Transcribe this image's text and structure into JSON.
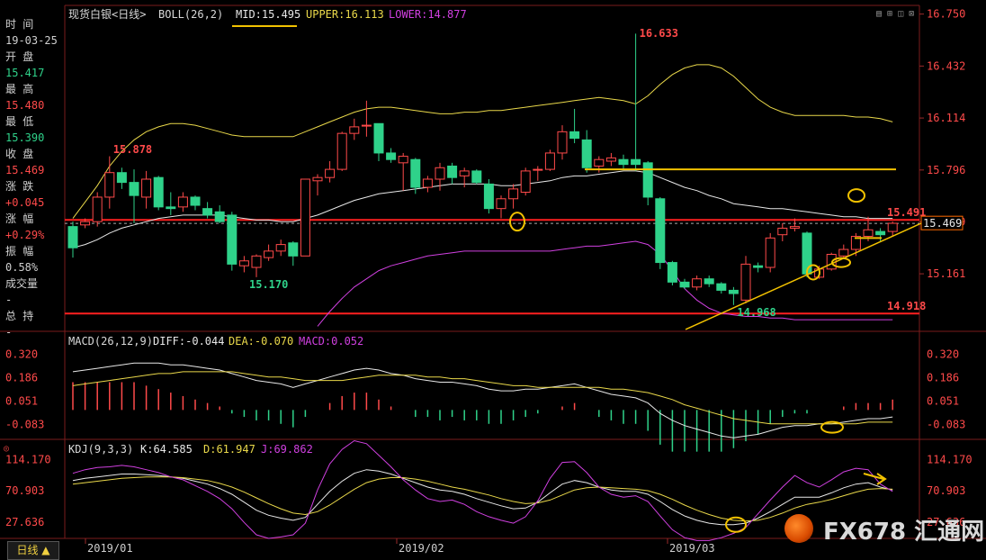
{
  "colors": {
    "up": "#ff4a4a",
    "down": "#2fd28a",
    "mid": "#e8e8e8",
    "upper": "#e9d84a",
    "lower": "#d040e0",
    "diff": "#e8e8e8",
    "dea": "#e9d84a",
    "k": "#e8e8e8",
    "d": "#e9d84a",
    "j": "#d040e0",
    "annot": "#f2c200",
    "level": "#ff2020"
  },
  "header": {
    "title": "现货白银<日线>",
    "indicator": "BOLL(26,2)",
    "mid": "MID:15.495",
    "upper": "UPPER:16.113",
    "lower": "LOWER:14.877"
  },
  "info_panel": {
    "time_label": "时 间",
    "time_value": "19-03-25",
    "open_label": "开 盘",
    "open_value": "15.417",
    "high_label": "最 高",
    "high_value": "15.480",
    "low_label": "最 低",
    "low_value": "15.390",
    "close_label": "收 盘",
    "close_value": "15.469",
    "change_label": "涨 跌",
    "change_value": "+0.045",
    "pct_label": "涨 幅",
    "pct_value": "+0.29%",
    "amp_label": "振 幅",
    "amp_value": "0.58%",
    "vol_label": "成交量",
    "vol_value": "-",
    "hold_label": "总 持",
    "hold_value": "-"
  },
  "tab": {
    "label": "日线 ▲"
  },
  "watermark": {
    "text": "FX678 汇通网"
  },
  "macd_header": {
    "name": "MACD(26,12,9)",
    "diff": "DIFF:-0.044",
    "dea": "DEA:-0.070",
    "macd": "MACD:0.052"
  },
  "kdj_header": {
    "name": "KDJ(9,3,3)",
    "k": "K:64.585",
    "d": "D:61.947",
    "j": "J:69.862"
  },
  "chart_data": [
    {
      "type": "candlestick",
      "x_ticks": [
        "2019/01",
        "2019/02",
        "2019/03"
      ],
      "y_ticks": [
        16.75,
        16.432,
        16.114,
        15.796,
        15.479,
        15.161
      ],
      "ylim": [
        14.82,
        16.77
      ],
      "last_price": "15.469",
      "labels": {
        "high_peak": "16.633",
        "left_high": "15.878",
        "left_low": "15.170",
        "right_low": "14.968",
        "resistance": "15.491",
        "support": "14.918"
      },
      "levels": [
        15.491,
        14.918
      ],
      "candles": [
        [
          15.45,
          15.48,
          15.26,
          15.32
        ],
        [
          15.46,
          15.5,
          15.44,
          15.48
        ],
        [
          15.48,
          15.66,
          15.45,
          15.63
        ],
        [
          15.63,
          15.88,
          15.56,
          15.78
        ],
        [
          15.78,
          15.81,
          15.68,
          15.72
        ],
        [
          15.72,
          15.8,
          15.47,
          15.64
        ],
        [
          15.63,
          15.79,
          15.56,
          15.74
        ],
        [
          15.75,
          15.76,
          15.55,
          15.57
        ],
        [
          15.57,
          15.66,
          15.52,
          15.56
        ],
        [
          15.57,
          15.66,
          15.54,
          15.63
        ],
        [
          15.63,
          15.64,
          15.55,
          15.58
        ],
        [
          15.56,
          15.6,
          15.5,
          15.52
        ],
        [
          15.54,
          15.58,
          15.47,
          15.48
        ],
        [
          15.52,
          15.54,
          15.18,
          15.22
        ],
        [
          15.21,
          15.27,
          15.17,
          15.24
        ],
        [
          15.2,
          15.28,
          15.14,
          15.27
        ],
        [
          15.26,
          15.34,
          15.24,
          15.3
        ],
        [
          15.3,
          15.37,
          15.27,
          15.34
        ],
        [
          15.35,
          15.36,
          15.21,
          15.27
        ],
        [
          15.27,
          15.74,
          15.27,
          15.74
        ],
        [
          15.73,
          15.77,
          15.64,
          15.75
        ],
        [
          15.75,
          15.85,
          15.72,
          15.8
        ],
        [
          15.8,
          16.03,
          15.79,
          16.02
        ],
        [
          16.02,
          16.11,
          15.98,
          16.06
        ],
        [
          16.07,
          16.22,
          16.0,
          16.07
        ],
        [
          16.08,
          16.08,
          15.85,
          15.9
        ],
        [
          15.9,
          15.93,
          15.84,
          15.86
        ],
        [
          15.84,
          15.9,
          15.67,
          15.88
        ],
        [
          15.86,
          15.87,
          15.65,
          15.69
        ],
        [
          15.69,
          15.76,
          15.66,
          15.74
        ],
        [
          15.74,
          15.84,
          15.67,
          15.81
        ],
        [
          15.82,
          15.84,
          15.71,
          15.75
        ],
        [
          15.76,
          15.81,
          15.69,
          15.79
        ],
        [
          15.79,
          15.8,
          15.71,
          15.72
        ],
        [
          15.71,
          15.74,
          15.53,
          15.56
        ],
        [
          15.56,
          15.64,
          15.5,
          15.62
        ],
        [
          15.62,
          15.71,
          15.56,
          15.68
        ],
        [
          15.66,
          15.81,
          15.64,
          15.79
        ],
        [
          15.8,
          15.82,
          15.73,
          15.8
        ],
        [
          15.8,
          15.92,
          15.79,
          15.9
        ],
        [
          15.9,
          16.07,
          15.86,
          16.03
        ],
        [
          16.03,
          16.17,
          15.96,
          15.99
        ],
        [
          15.98,
          16.04,
          15.78,
          15.81
        ],
        [
          15.82,
          15.88,
          15.78,
          15.86
        ],
        [
          15.85,
          15.9,
          15.82,
          15.87
        ],
        [
          15.86,
          15.89,
          15.8,
          15.83
        ],
        [
          15.86,
          16.63,
          15.79,
          15.83
        ],
        [
          15.84,
          15.85,
          15.58,
          15.63
        ],
        [
          15.62,
          15.63,
          15.19,
          15.23
        ],
        [
          15.23,
          15.24,
          15.09,
          15.11
        ],
        [
          15.11,
          15.13,
          15.07,
          15.08
        ],
        [
          15.08,
          15.15,
          15.06,
          15.13
        ],
        [
          15.13,
          15.15,
          15.08,
          15.1
        ],
        [
          15.1,
          15.11,
          15.04,
          15.06
        ],
        [
          15.06,
          15.08,
          14.97,
          15.04
        ],
        [
          15.0,
          15.27,
          14.98,
          15.22
        ],
        [
          15.21,
          15.23,
          15.17,
          15.2
        ],
        [
          15.2,
          15.41,
          15.17,
          15.38
        ],
        [
          15.4,
          15.47,
          15.36,
          15.44
        ],
        [
          15.44,
          15.5,
          15.42,
          15.45
        ],
        [
          15.41,
          15.42,
          15.14,
          15.16
        ],
        [
          15.14,
          15.21,
          15.13,
          15.19
        ],
        [
          15.19,
          15.29,
          15.18,
          15.28
        ],
        [
          15.27,
          15.34,
          15.25,
          15.31
        ],
        [
          15.31,
          15.41,
          15.27,
          15.39
        ],
        [
          15.39,
          15.51,
          15.36,
          15.43
        ],
        [
          15.42,
          15.44,
          15.36,
          15.4
        ],
        [
          15.42,
          15.48,
          15.39,
          15.47
        ]
      ],
      "mid": [
        15.32,
        15.34,
        15.37,
        15.41,
        15.44,
        15.46,
        15.48,
        15.5,
        15.51,
        15.52,
        15.52,
        15.52,
        15.52,
        15.51,
        15.5,
        15.49,
        15.49,
        15.48,
        15.48,
        15.5,
        15.52,
        15.55,
        15.58,
        15.61,
        15.63,
        15.65,
        15.66,
        15.67,
        15.68,
        15.69,
        15.7,
        15.71,
        15.71,
        15.71,
        15.71,
        15.7,
        15.7,
        15.71,
        15.72,
        15.73,
        15.75,
        15.76,
        15.76,
        15.77,
        15.78,
        15.79,
        15.79,
        15.78,
        15.75,
        15.72,
        15.69,
        15.67,
        15.64,
        15.62,
        15.59,
        15.58,
        15.57,
        15.56,
        15.56,
        15.55,
        15.54,
        15.53,
        15.52,
        15.51,
        15.51,
        15.5,
        15.5,
        15.5
      ],
      "upper": [
        15.5,
        15.6,
        15.7,
        15.82,
        15.91,
        15.98,
        16.03,
        16.06,
        16.08,
        16.08,
        16.07,
        16.05,
        16.03,
        16.01,
        16.0,
        16.0,
        16.0,
        16.0,
        16.0,
        16.03,
        16.06,
        16.09,
        16.12,
        16.15,
        16.17,
        16.18,
        16.18,
        16.17,
        16.16,
        16.15,
        16.14,
        16.14,
        16.15,
        16.15,
        16.16,
        16.16,
        16.17,
        16.18,
        16.19,
        16.2,
        16.21,
        16.22,
        16.23,
        16.24,
        16.23,
        16.22,
        16.2,
        16.25,
        16.32,
        16.38,
        16.42,
        16.44,
        16.44,
        16.42,
        16.37,
        16.3,
        16.23,
        16.18,
        16.15,
        16.13,
        16.13,
        16.13,
        16.13,
        16.13,
        16.12,
        16.12,
        16.11,
        16.09
      ],
      "lower": [
        null,
        null,
        null,
        null,
        null,
        null,
        null,
        null,
        null,
        null,
        null,
        null,
        null,
        null,
        null,
        null,
        null,
        null,
        null,
        null,
        14.84,
        14.93,
        15.01,
        15.08,
        15.13,
        15.18,
        15.21,
        15.23,
        15.25,
        15.27,
        15.28,
        15.29,
        15.3,
        15.3,
        15.3,
        15.3,
        15.3,
        15.3,
        15.3,
        15.3,
        15.31,
        15.32,
        15.33,
        15.33,
        15.34,
        15.35,
        15.36,
        15.34,
        15.28,
        15.18,
        15.07,
        15.0,
        14.95,
        14.92,
        14.91,
        14.9,
        14.9,
        14.89,
        14.89,
        14.88,
        14.88,
        14.88,
        14.88,
        14.88,
        14.88,
        14.88,
        14.88,
        14.88
      ]
    },
    {
      "type": "macd",
      "y_ticks": [
        0.32,
        0.186,
        0.051,
        -0.083
      ],
      "ylim": [
        -0.19,
        0.37
      ],
      "diff": [
        0.22,
        0.23,
        0.24,
        0.25,
        0.26,
        0.27,
        0.27,
        0.27,
        0.26,
        0.26,
        0.25,
        0.24,
        0.23,
        0.21,
        0.19,
        0.17,
        0.16,
        0.15,
        0.13,
        0.15,
        0.17,
        0.19,
        0.21,
        0.23,
        0.24,
        0.23,
        0.21,
        0.2,
        0.18,
        0.17,
        0.16,
        0.16,
        0.15,
        0.14,
        0.12,
        0.11,
        0.11,
        0.12,
        0.12,
        0.13,
        0.14,
        0.15,
        0.13,
        0.11,
        0.09,
        0.08,
        0.07,
        0.04,
        -0.02,
        -0.06,
        -0.09,
        -0.11,
        -0.13,
        -0.15,
        -0.16,
        -0.15,
        -0.14,
        -0.12,
        -0.1,
        -0.09,
        -0.09,
        -0.08,
        -0.08,
        -0.07,
        -0.06,
        -0.05,
        -0.05,
        -0.04
      ],
      "dea": [
        0.14,
        0.15,
        0.16,
        0.17,
        0.18,
        0.19,
        0.2,
        0.21,
        0.21,
        0.22,
        0.22,
        0.22,
        0.22,
        0.22,
        0.21,
        0.2,
        0.19,
        0.19,
        0.18,
        0.17,
        0.17,
        0.17,
        0.17,
        0.18,
        0.19,
        0.2,
        0.2,
        0.2,
        0.2,
        0.19,
        0.19,
        0.18,
        0.18,
        0.17,
        0.16,
        0.15,
        0.14,
        0.14,
        0.13,
        0.13,
        0.13,
        0.13,
        0.13,
        0.13,
        0.12,
        0.12,
        0.11,
        0.1,
        0.08,
        0.06,
        0.03,
        0.01,
        -0.01,
        -0.03,
        -0.05,
        -0.06,
        -0.07,
        -0.08,
        -0.08,
        -0.08,
        -0.08,
        -0.08,
        -0.08,
        -0.08,
        -0.08,
        -0.07,
        -0.07,
        -0.07
      ]
    },
    {
      "type": "kdj",
      "y_ticks": [
        114.17,
        70.903,
        27.636
      ],
      "ylim": [
        5,
        122
      ],
      "k": [
        85,
        88,
        90,
        92,
        94,
        94,
        93,
        92,
        90,
        88,
        84,
        80,
        74,
        66,
        55,
        44,
        37,
        33,
        30,
        34,
        52,
        70,
        84,
        95,
        100,
        98,
        94,
        88,
        82,
        76,
        72,
        70,
        66,
        60,
        55,
        50,
        46,
        47,
        55,
        68,
        80,
        85,
        82,
        76,
        72,
        70,
        70,
        66,
        56,
        45,
        36,
        30,
        26,
        24,
        24,
        26,
        33,
        42,
        52,
        62,
        62,
        62,
        68,
        75,
        80,
        82,
        76,
        72
      ],
      "d": [
        80,
        82,
        84,
        86,
        88,
        89,
        90,
        90,
        90,
        89,
        87,
        85,
        81,
        76,
        69,
        61,
        53,
        46,
        40,
        38,
        42,
        51,
        62,
        73,
        82,
        87,
        89,
        89,
        87,
        84,
        80,
        76,
        73,
        69,
        65,
        60,
        56,
        53,
        54,
        58,
        65,
        72,
        75,
        76,
        75,
        74,
        73,
        71,
        66,
        59,
        51,
        44,
        38,
        33,
        30,
        29,
        30,
        34,
        40,
        47,
        52,
        55,
        59,
        64,
        69,
        73,
        74,
        73
      ],
      "j": [
        95,
        100,
        103,
        104,
        106,
        104,
        100,
        96,
        90,
        86,
        78,
        70,
        60,
        46,
        27,
        10,
        5,
        7,
        10,
        26,
        72,
        108,
        128,
        140,
        136,
        120,
        104,
        86,
        72,
        60,
        56,
        58,
        52,
        42,
        35,
        30,
        26,
        35,
        57,
        88,
        110,
        111,
        96,
        76,
        66,
        62,
        64,
        56,
        36,
        17,
        6,
        2,
        2,
        6,
        12,
        20,
        39,
        58,
        76,
        92,
        82,
        76,
        86,
        97,
        102,
        100,
        80,
        70
      ]
    }
  ]
}
